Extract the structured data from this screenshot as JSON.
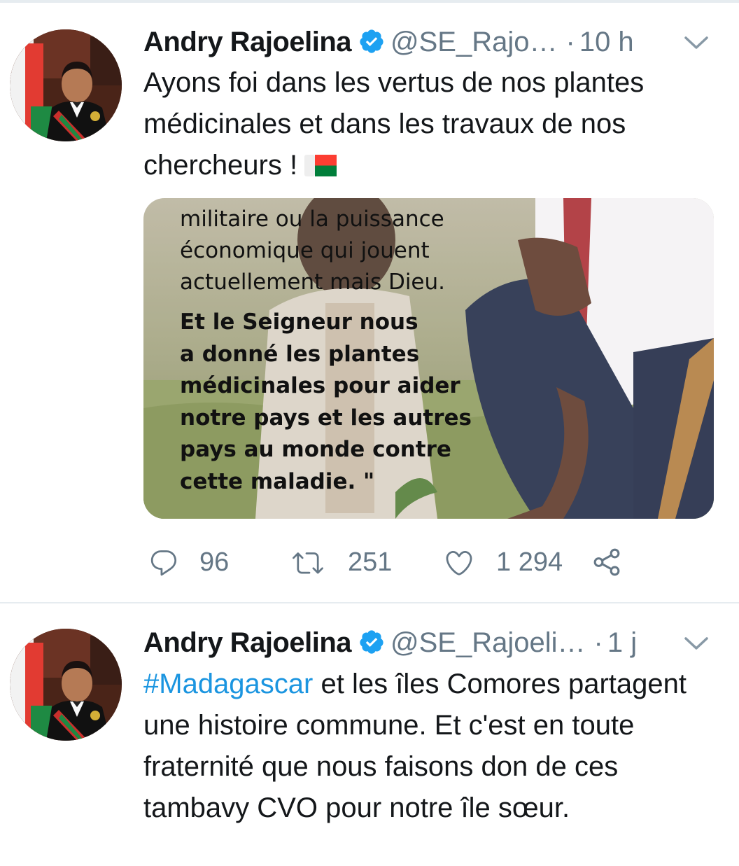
{
  "tweets": [
    {
      "author": "Andry Rajoelina",
      "handle": "@SE_Rajo…",
      "separator": "·",
      "time": "10 h",
      "text": "Ayons foi dans les vertus de nos plantes médicinales et dans les travaux de nos chercheurs !",
      "emoji": "madagascar-flag",
      "media": {
        "quote_plain": "militaire ou la puissance\néconomique qui jouent\nactuellement mais Dieu.",
        "quote_bold": "Et le Seigneur nous\na donné les plantes\nmédicinales pour aider\nnotre pays et les autres\npays au monde contre\ncette maladie. \""
      },
      "actions": {
        "replies": "96",
        "retweets": "251",
        "likes": "1 294"
      }
    },
    {
      "author": "Andry Rajoelina",
      "handle": "@SE_Rajoeli…",
      "separator": "·",
      "time": "1 j",
      "hashtag": "#Madagascar",
      "text": " et les îles Comores partagent une histoire commune. Et c'est en toute fraternité que nous faisons don de ces tambavy CVO pour notre île sœur."
    }
  ],
  "icons": {
    "verified": "verified-badge-icon",
    "chevron": "chevron-down-icon",
    "reply": "reply-icon",
    "retweet": "retweet-icon",
    "like": "heart-icon",
    "share": "share-icon"
  },
  "colors": {
    "accent": "#1da1f2",
    "hashtag": "#1b95e0",
    "muted": "#657786",
    "text": "#14171a",
    "flag_red": "#fc3d32",
    "flag_green": "#007e3a"
  }
}
